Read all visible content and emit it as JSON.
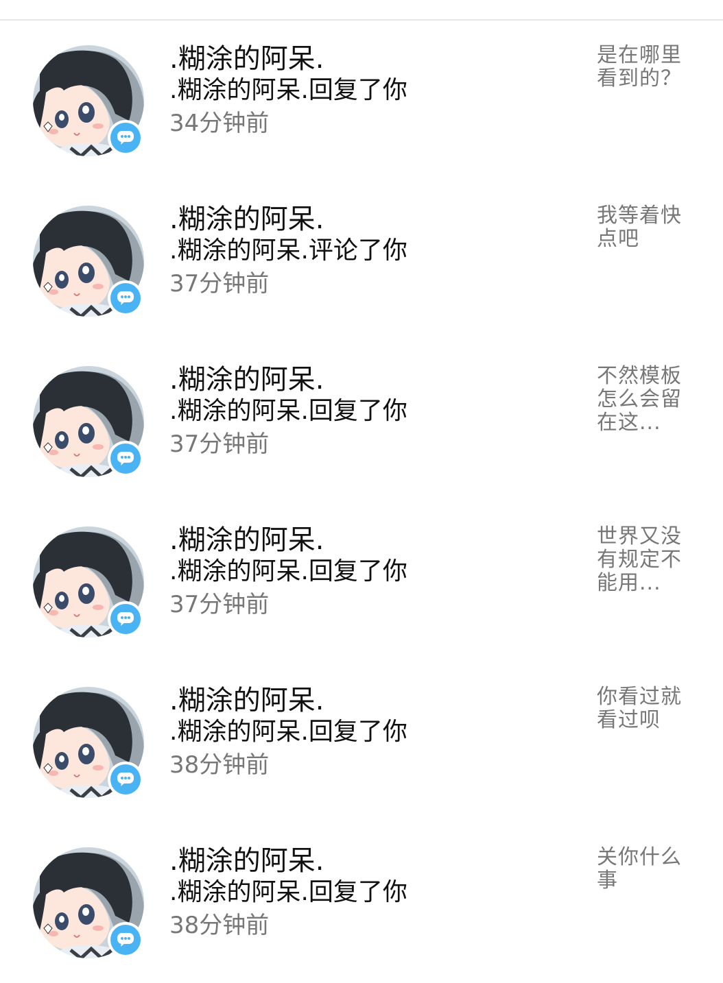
{
  "notifications": [
    {
      "name": ".糊涂的阿呆.",
      "action": ".糊涂的阿呆.回复了你",
      "time": "34分钟前",
      "preview": "是在哪里看到的？"
    },
    {
      "name": ".糊涂的阿呆.",
      "action": ".糊涂的阿呆.评论了你",
      "time": "37分钟前",
      "preview": "我等着快点吧"
    },
    {
      "name": ".糊涂的阿呆.",
      "action": ".糊涂的阿呆.回复了你",
      "time": "37分钟前",
      "preview": "不然模板怎么会留在这..."
    },
    {
      "name": ".糊涂的阿呆.",
      "action": ".糊涂的阿呆.回复了你",
      "time": "37分钟前",
      "preview": "世界又没有规定不能用..."
    },
    {
      "name": ".糊涂的阿呆.",
      "action": ".糊涂的阿呆.回复了你",
      "time": "38分钟前",
      "preview": "你看过就看过呗"
    },
    {
      "name": ".糊涂的阿呆.",
      "action": ".糊涂的阿呆.回复了你",
      "time": "38分钟前",
      "preview": "关你什么事"
    }
  ],
  "colors": {
    "badge": "#4ab3f4",
    "primary_text": "#111111",
    "secondary_text": "#777777",
    "divider": "#e6e6e6"
  },
  "icons": {
    "avatar": "anime-girl-avatar",
    "badge": "comment-bubble-icon"
  }
}
